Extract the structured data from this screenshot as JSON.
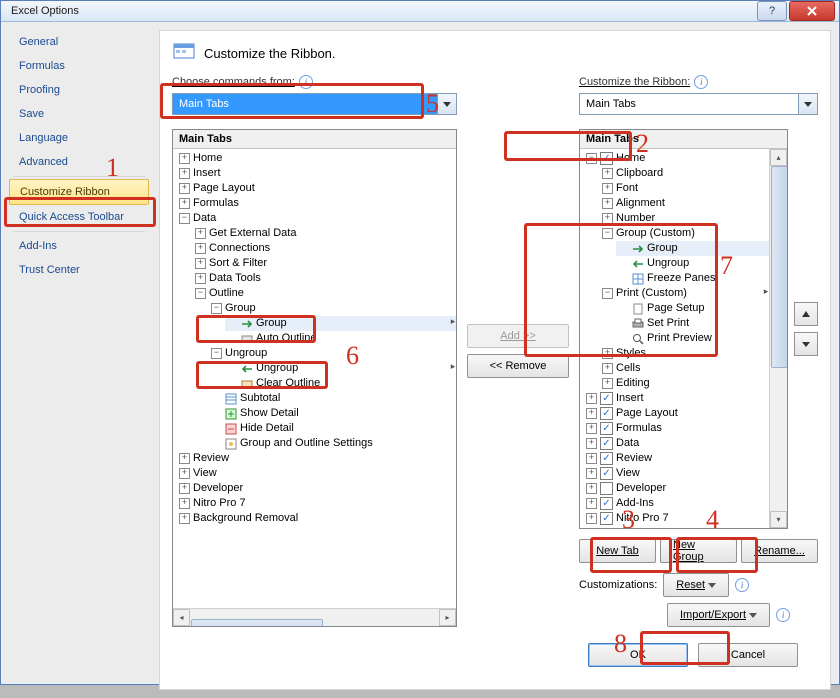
{
  "window": {
    "title": "Excel Options"
  },
  "titlebar_buttons": {
    "help": "?",
    "close": "✕"
  },
  "sidebar": {
    "items": [
      "General",
      "Formulas",
      "Proofing",
      "Save",
      "Language",
      "Advanced",
      "Customize Ribbon",
      "Quick Access Toolbar",
      "Add-Ins",
      "Trust Center"
    ],
    "selected": "Customize Ribbon"
  },
  "heading": "Customize the Ribbon.",
  "left": {
    "label": "Choose commands from:",
    "dropdown": "Main Tabs",
    "tree_title": "Main Tabs",
    "tree": [
      {
        "exp": "+",
        "label": "Home"
      },
      {
        "exp": "+",
        "label": "Insert"
      },
      {
        "exp": "+",
        "label": "Page Layout"
      },
      {
        "exp": "+",
        "label": "Formulas"
      },
      {
        "exp": "-",
        "label": "Data",
        "children": [
          {
            "exp": "+",
            "label": "Get External Data"
          },
          {
            "exp": "+",
            "label": "Connections"
          },
          {
            "exp": "+",
            "label": "Sort & Filter"
          },
          {
            "exp": "+",
            "label": "Data Tools"
          },
          {
            "exp": "-",
            "label": "Outline",
            "children": [
              {
                "exp": "-",
                "label": "Group",
                "fly": true,
                "children": [
                  {
                    "icon": "group",
                    "label": "Group",
                    "sel": true
                  },
                  {
                    "icon": "auto",
                    "label": "Auto Outline"
                  }
                ]
              },
              {
                "exp": "-",
                "label": "Ungroup",
                "fly": true,
                "children": [
                  {
                    "icon": "ungroup",
                    "label": "Ungroup"
                  },
                  {
                    "icon": "clear",
                    "label": "Clear Outline"
                  }
                ]
              },
              {
                "icon": "subtotal",
                "label": "Subtotal"
              },
              {
                "icon": "showdetail",
                "label": "Show Detail"
              },
              {
                "icon": "hidedetail",
                "label": "Hide Detail"
              },
              {
                "icon": "gos",
                "label": "Group and Outline Settings"
              }
            ]
          }
        ]
      },
      {
        "exp": "+",
        "label": "Review"
      },
      {
        "exp": "+",
        "label": "View"
      },
      {
        "exp": "+",
        "label": "Developer"
      },
      {
        "exp": "+",
        "label": "Nitro Pro 7"
      },
      {
        "exp": "+",
        "label": "Background Removal"
      }
    ]
  },
  "mid": {
    "add": "Add >>",
    "remove": "<< Remove"
  },
  "right": {
    "label": "Customize the Ribbon:",
    "dropdown": "Main Tabs",
    "tree_title": "Main Tabs",
    "tree": [
      {
        "exp": "-",
        "chk": true,
        "label": "Home",
        "children": [
          {
            "exp": "+",
            "label": "Clipboard"
          },
          {
            "exp": "+",
            "label": "Font"
          },
          {
            "exp": "+",
            "label": "Alignment"
          },
          {
            "exp": "+",
            "label": "Number"
          },
          {
            "exp": "-",
            "label": "Group (Custom)",
            "children": [
              {
                "icon": "group",
                "label": "Group",
                "sel": true
              },
              {
                "icon": "ungroup",
                "label": "Ungroup"
              },
              {
                "icon": "freeze",
                "label": "Freeze Panes",
                "fly": true
              }
            ]
          },
          {
            "exp": "-",
            "label": "Print (Custom)",
            "children": [
              {
                "icon": "pagesetup",
                "label": "Page Setup"
              },
              {
                "icon": "setprint",
                "label": "Set Print"
              },
              {
                "icon": "preview",
                "label": "Print Preview"
              }
            ]
          },
          {
            "exp": "+",
            "label": "Styles"
          },
          {
            "exp": "+",
            "label": "Cells"
          },
          {
            "exp": "+",
            "label": "Editing"
          }
        ]
      },
      {
        "exp": "+",
        "chk": true,
        "label": "Insert"
      },
      {
        "exp": "+",
        "chk": true,
        "label": "Page Layout"
      },
      {
        "exp": "+",
        "chk": true,
        "label": "Formulas"
      },
      {
        "exp": "+",
        "chk": true,
        "label": "Data"
      },
      {
        "exp": "+",
        "chk": true,
        "label": "Review"
      },
      {
        "exp": "+",
        "chk": true,
        "label": "View"
      },
      {
        "exp": "+",
        "chk": false,
        "label": "Developer"
      },
      {
        "exp": "+",
        "chk": true,
        "label": "Add-Ins"
      },
      {
        "exp": "+",
        "chk": true,
        "label": "Nitro Pro 7",
        "cut": true
      }
    ],
    "buttons": {
      "newtab": "New Tab",
      "newgroup": "New Group",
      "rename": "Rename..."
    },
    "customizations_label": "Customizations:",
    "reset": "Reset",
    "importexport": "Import/Export"
  },
  "footer": {
    "ok": "OK",
    "cancel": "Cancel"
  },
  "annotations": {
    "1": "1",
    "2": "2",
    "3": "3",
    "4": "4",
    "5": "5",
    "6": "6",
    "7": "7",
    "8": "8"
  }
}
